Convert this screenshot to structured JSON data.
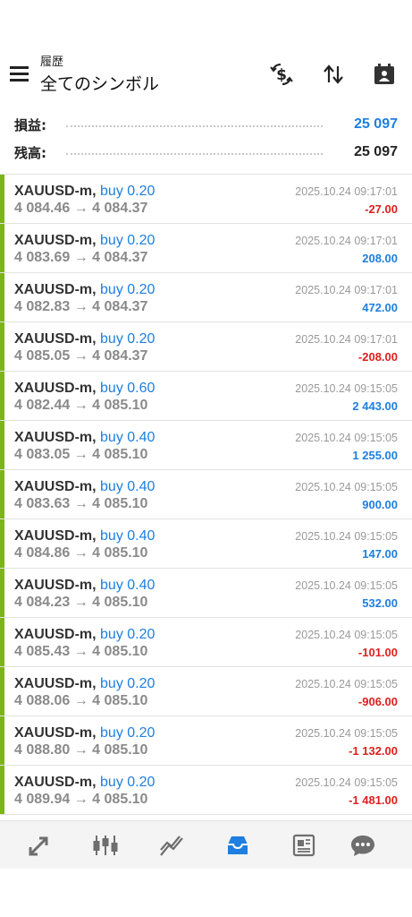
{
  "header": {
    "subtitle": "履歴",
    "title": "全てのシンボル",
    "icons": [
      "menu-icon",
      "currency-exchange-icon",
      "sort-icon",
      "calendar-icon"
    ]
  },
  "summary": {
    "profit_label": "損益:",
    "profit_value": "25 097",
    "balance_label": "残高:",
    "balance_value": "25 097",
    "colors": {
      "profit": "#1e7fe0",
      "balance": "#222222"
    }
  },
  "trades": [
    {
      "symbol": "XAUUSD-m,",
      "side": "buy 0.20",
      "prices": "4 084.46 → 4 084.37",
      "time": "2025.10.24 09:17:01",
      "profit": "-27.00",
      "negative": true
    },
    {
      "symbol": "XAUUSD-m,",
      "side": "buy 0.20",
      "prices": "4 083.69 → 4 084.37",
      "time": "2025.10.24 09:17:01",
      "profit": "208.00",
      "negative": false
    },
    {
      "symbol": "XAUUSD-m,",
      "side": "buy 0.20",
      "prices": "4 082.83 → 4 084.37",
      "time": "2025.10.24 09:17:01",
      "profit": "472.00",
      "negative": false
    },
    {
      "symbol": "XAUUSD-m,",
      "side": "buy 0.20",
      "prices": "4 085.05 → 4 084.37",
      "time": "2025.10.24 09:17:01",
      "profit": "-208.00",
      "negative": true
    },
    {
      "symbol": "XAUUSD-m,",
      "side": "buy 0.60",
      "prices": "4 082.44 → 4 085.10",
      "time": "2025.10.24 09:15:05",
      "profit": "2 443.00",
      "negative": false
    },
    {
      "symbol": "XAUUSD-m,",
      "side": "buy 0.40",
      "prices": "4 083.05 → 4 085.10",
      "time": "2025.10.24 09:15:05",
      "profit": "1 255.00",
      "negative": false
    },
    {
      "symbol": "XAUUSD-m,",
      "side": "buy 0.40",
      "prices": "4 083.63 → 4 085.10",
      "time": "2025.10.24 09:15:05",
      "profit": "900.00",
      "negative": false
    },
    {
      "symbol": "XAUUSD-m,",
      "side": "buy 0.40",
      "prices": "4 084.86 → 4 085.10",
      "time": "2025.10.24 09:15:05",
      "profit": "147.00",
      "negative": false
    },
    {
      "symbol": "XAUUSD-m,",
      "side": "buy 0.40",
      "prices": "4 084.23 → 4 085.10",
      "time": "2025.10.24 09:15:05",
      "profit": "532.00",
      "negative": false
    },
    {
      "symbol": "XAUUSD-m,",
      "side": "buy 0.20",
      "prices": "4 085.43 → 4 085.10",
      "time": "2025.10.24 09:15:05",
      "profit": "-101.00",
      "negative": true
    },
    {
      "symbol": "XAUUSD-m,",
      "side": "buy 0.20",
      "prices": "4 088.06 → 4 085.10",
      "time": "2025.10.24 09:15:05",
      "profit": "-906.00",
      "negative": true
    },
    {
      "symbol": "XAUUSD-m,",
      "side": "buy 0.20",
      "prices": "4 088.80 → 4 085.10",
      "time": "2025.10.24 09:15:05",
      "profit": "-1 132.00",
      "negative": true
    },
    {
      "symbol": "XAUUSD-m,",
      "side": "buy 0.20",
      "prices": "4 089.94 → 4 085.10",
      "time": "2025.10.24 09:15:05",
      "profit": "-1 481.00",
      "negative": true
    }
  ],
  "colors": {
    "buy": "#1e7fe0",
    "positive": "#1e7fe0",
    "negative": "#e01e1e",
    "row_marker": "#7cb518",
    "nav_inactive": "#6e6e6e",
    "nav_active": "#1e7fe0"
  },
  "bottom_nav": {
    "items": [
      "quotes-icon",
      "chart-icon",
      "trade-icon",
      "history-icon",
      "news-icon",
      "chat-icon"
    ],
    "active": "history-icon"
  }
}
